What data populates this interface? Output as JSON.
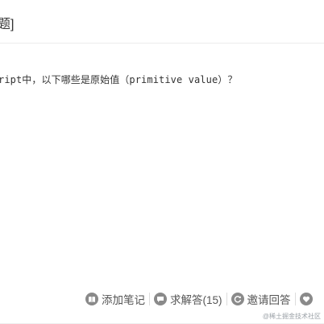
{
  "header": {
    "title": "题]"
  },
  "question": {
    "text": "ript中，以下哪些是原始值（primitive value）？"
  },
  "actions": [
    {
      "icon": "book-icon",
      "label": "添加笔记"
    },
    {
      "icon": "chat-bubble-icon",
      "label": "求解答(15)"
    },
    {
      "icon": "refresh-icon",
      "label": "邀请回答"
    },
    {
      "icon": "heart-icon",
      "label": ""
    }
  ],
  "watermark": {
    "text": "@稀土掘金技术社区"
  },
  "colors": {
    "icon_bg": "#8a8a8a",
    "text": "#333333",
    "action_text": "#555555"
  }
}
